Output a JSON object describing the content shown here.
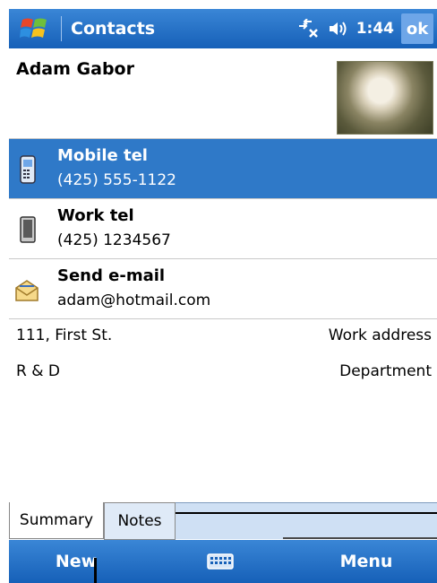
{
  "titlebar": {
    "title": "Contacts",
    "time": "1:44",
    "ok_label": "ok"
  },
  "contact": {
    "name": "Adam Gabor"
  },
  "details": [
    {
      "label": "Mobile tel",
      "value": "(425) 555-1122",
      "icon": "mobile-phone-icon",
      "selected": true
    },
    {
      "label": "Work tel",
      "value": "(425) 1234567",
      "icon": "desk-phone-icon",
      "selected": false
    },
    {
      "label": "Send e-mail",
      "value": "adam@hotmail.com",
      "icon": "envelope-icon",
      "selected": false
    }
  ],
  "address": {
    "value": "111, First St.",
    "label": "Work address"
  },
  "department": {
    "value": "R & D",
    "label": "Department"
  },
  "tabs": {
    "summary": "Summary",
    "notes": "Notes"
  },
  "menubar": {
    "new_label": "New",
    "menu_label": "Menu"
  },
  "colors": {
    "accent": "#1660b8",
    "selected_row": "#2f79c8"
  }
}
